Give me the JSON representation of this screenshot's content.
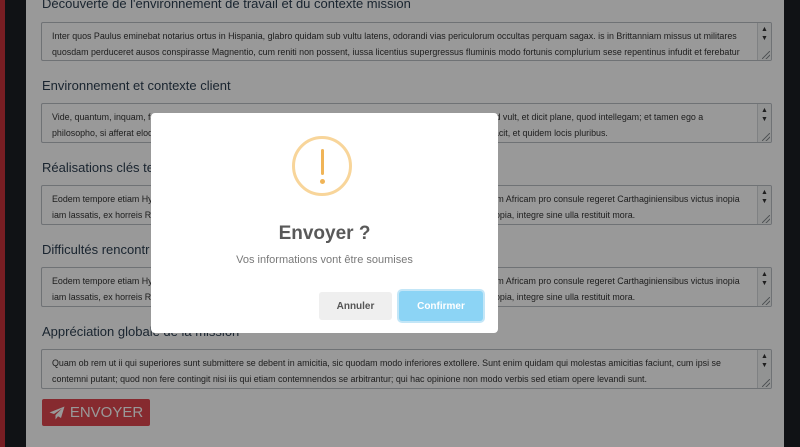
{
  "form": {
    "sections": [
      {
        "title": "Découverte de l'environnement de travail et du contexte mission",
        "text": "Inter quos Paulus eminebat notarius ortus in Hispania, glabro quidam sub vultu latens, odorandi vias periculorum occultas perquam sagax. is in Brittanniam missus ut militares quosdam perduceret ausos conspirasse Magnentio, cum reniti non possent, iussa licentius supergressus fluminis modo fortunis complurium sese repentinus infudit et ferebatur per strages multiplices ac ruinas."
      },
      {
        "title": "Environnement et contexte client",
        "text": "Vide, quantum, inquam, fallare, Torquate. oratio me istius philosophi non offendit; nam et complectitur verbis, quod vult, et dicit plane, quod intellegam; et tamen ego a philosopho, si afferat eloquentiam, non asperner, si non habeat, non admodum flagitem. re mihi non aeque satisfacit, et quidem locis pluribus."
      },
      {
        "title": "Réalisations clés te",
        "text": "Eodem tempore etiam Hymetii praeclarae indolis viri negotium est actitatum, cuius hunc novimus esse textum. cum Africam pro consule regeret Carthaginiensibus victus inopia iam lassatis, ex horreis Romano populo destinatis frumentum dedit, pauloque postea cum provenisset segetum copia, integre sine ulla restituit mora."
      },
      {
        "title": "Difficultés rencontr",
        "text": "Eodem tempore etiam Hymetii praeclarae indolis viri negotium est actitatum, cuius hunc novimus esse textum. cum Africam pro consule regeret Carthaginiensibus victus inopia iam lassatis, ex horreis Romano populo destinatis frumentum dedit, pauloque postea cum provenisset segetum copia, integre sine ulla restituit mora."
      },
      {
        "title": "Appréciation globale de la mission",
        "text": "Quam ob rem ut ii qui superiores sunt submittere se debent in amicitia, sic quodam modo inferiores extollere. Sunt enim quidam qui molestas amicitias faciunt, cum ipsi se contemni putant; quod non fere contingit nisi iis qui etiam contemnendos se arbitrantur; qui hac opinione non modo verbis sed etiam opere levandi sunt."
      }
    ],
    "submit_label": "ENVOYER",
    "submit_icon": "paper-plane-icon"
  },
  "modal": {
    "icon": "warning-icon",
    "icon_color": "#f8bb86",
    "title": "Envoyer ?",
    "message": "Vos informations vont être soumises",
    "cancel_label": "Annuler",
    "confirm_label": "Confirmer",
    "confirm_color": "#8cd4f5"
  },
  "colors": {
    "accent": "#e0464f",
    "frame_accent": "#c9323b",
    "section_title": "#2c3e50"
  }
}
